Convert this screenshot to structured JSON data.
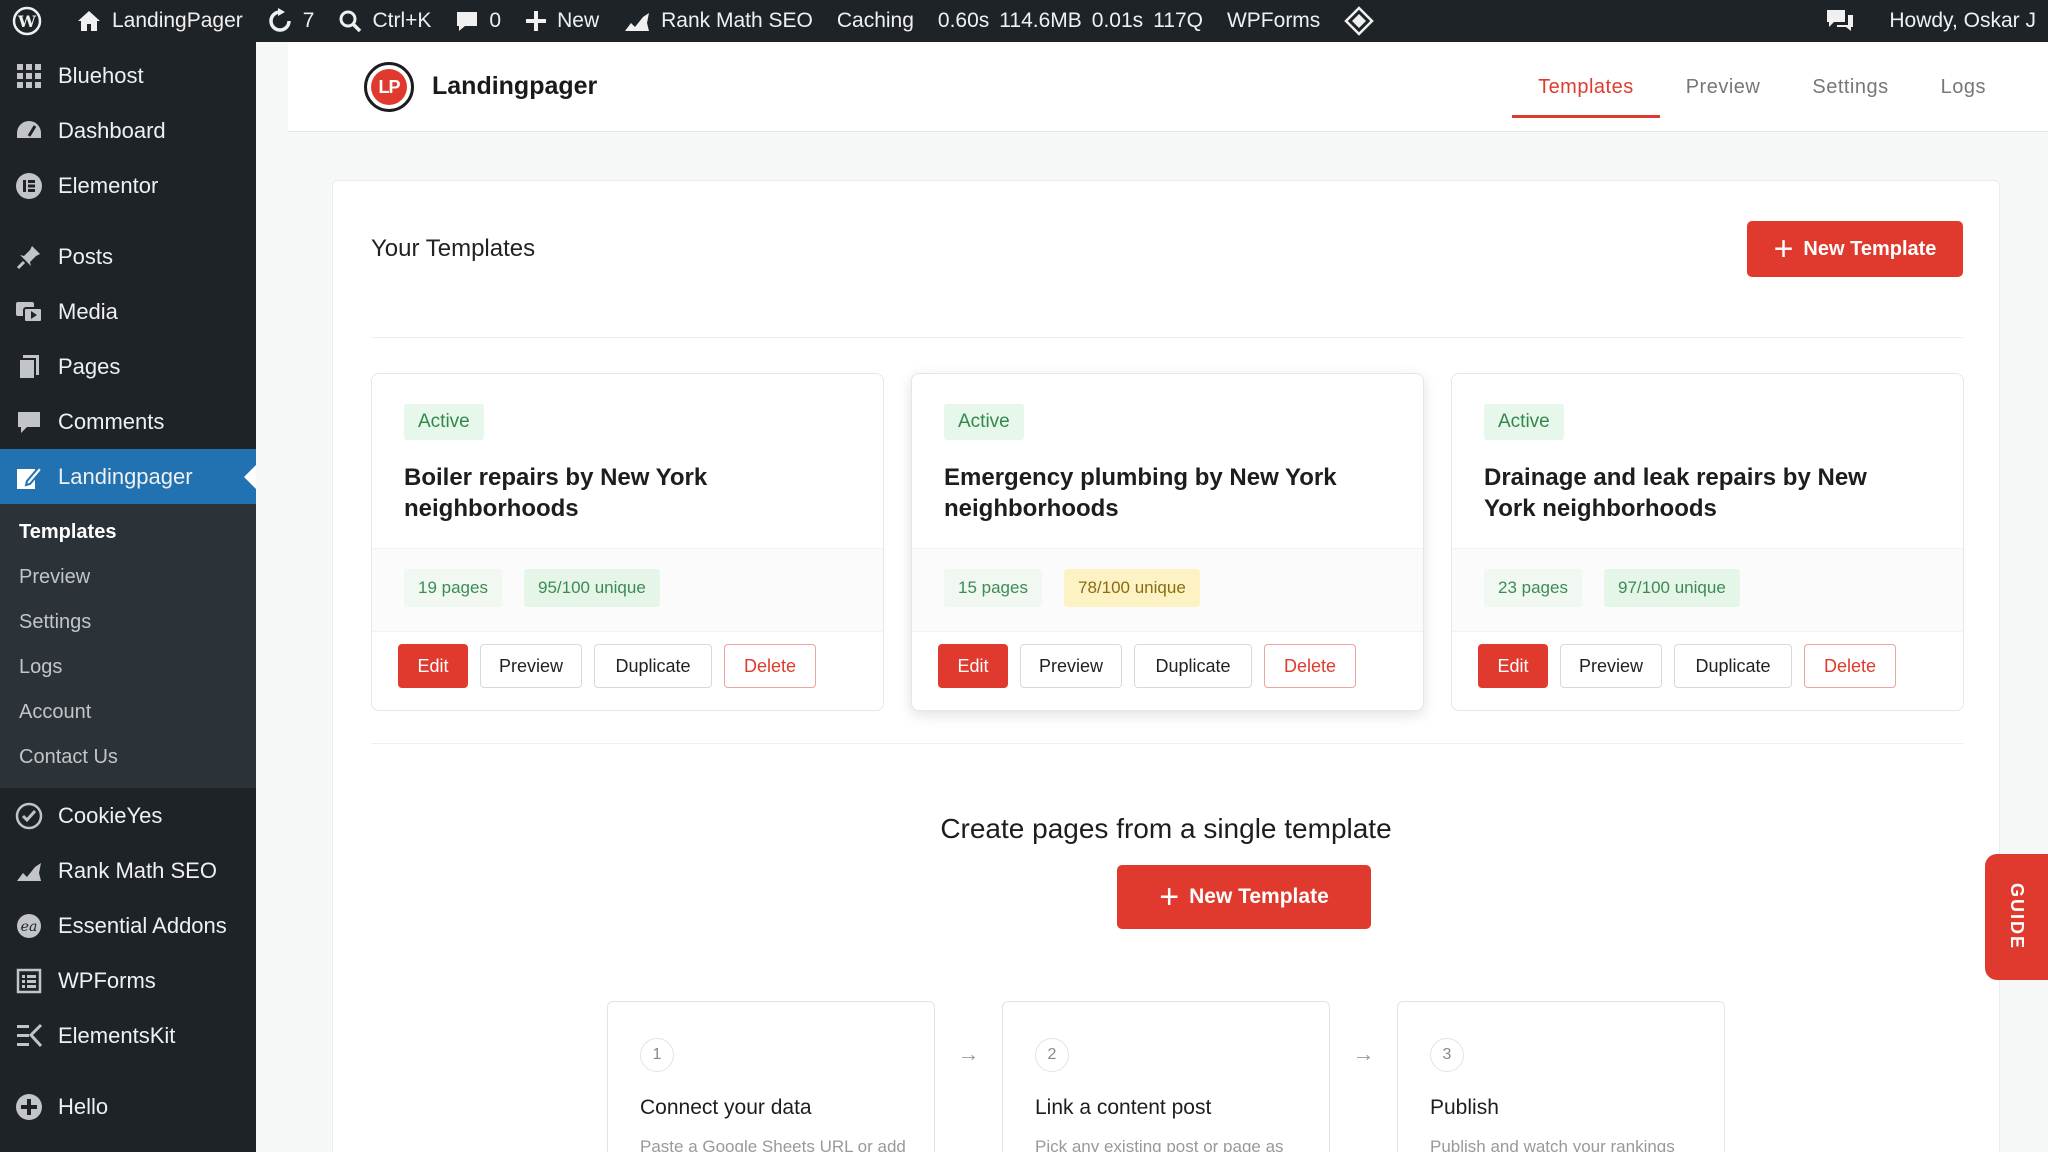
{
  "adminbar": {
    "site_name": "LandingPager",
    "updates": "7",
    "search_shortcut": "Ctrl+K",
    "comments": "0",
    "new_label": "New",
    "rankmath": "Rank Math SEO",
    "caching": "Caching",
    "metrics": [
      "0.60s",
      "114.6MB",
      "0.01s",
      "117Q"
    ],
    "wpforms": "WPForms",
    "howdy": "Howdy, Oskar J"
  },
  "sidebar": {
    "items": [
      {
        "label": "Bluehost"
      },
      {
        "label": "Dashboard"
      },
      {
        "label": "Elementor"
      },
      {
        "label": "Posts"
      },
      {
        "label": "Media"
      },
      {
        "label": "Pages"
      },
      {
        "label": "Comments"
      },
      {
        "label": "Landingpager"
      },
      {
        "label": "CookieYes"
      },
      {
        "label": "Rank Math SEO"
      },
      {
        "label": "Essential Addons"
      },
      {
        "label": "WPForms"
      },
      {
        "label": "ElementsKit"
      },
      {
        "label": "Hello"
      }
    ],
    "submenu": [
      "Templates",
      "Preview",
      "Settings",
      "Logs",
      "Account",
      "Contact Us"
    ]
  },
  "header": {
    "logo_text": "LP",
    "brand": "Landingpager",
    "tabs": [
      "Templates",
      "Preview",
      "Settings",
      "Logs"
    ]
  },
  "main": {
    "title": "Your Templates",
    "new_template": "New Template",
    "cards": [
      {
        "status": "Active",
        "title": "Boiler repairs by New York neighborhoods",
        "pages": "19 pages",
        "unique": "95/100 unique"
      },
      {
        "status": "Active",
        "title": "Emergency plumbing by New York neighborhoods",
        "pages": "15 pages",
        "unique": "78/100 unique"
      },
      {
        "status": "Active",
        "title": "Drainage and leak repairs by New York neighborhoods",
        "pages": "23 pages",
        "unique": "97/100 unique"
      }
    ],
    "actions": {
      "edit": "Edit",
      "preview": "Preview",
      "duplicate": "Duplicate",
      "delete": "Delete"
    },
    "cta_title": "Create pages from a single template",
    "steps": [
      {
        "num": "1",
        "title": "Connect your data",
        "desc": "Paste a Google Sheets URL or add rows manually. Each row"
      },
      {
        "num": "2",
        "title": "Link a content post",
        "desc": "Pick any existing post or page as your layout. Place [variable]"
      },
      {
        "num": "3",
        "title": "Publish",
        "desc": "Publish and watch your rankings skyrocket."
      }
    ],
    "arrow": "→"
  },
  "guide": "GUIDE",
  "colors": {
    "accent": "#e03a2e",
    "wp_dark": "#1d2327",
    "wp_blue": "#2271b1"
  }
}
